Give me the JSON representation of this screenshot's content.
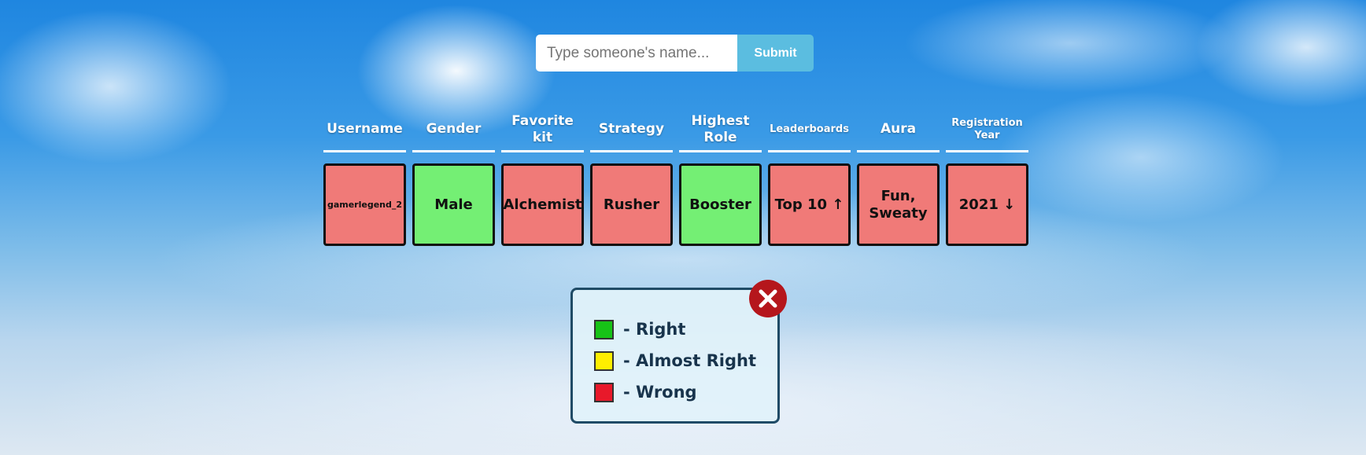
{
  "search": {
    "placeholder": "Type someone's name...",
    "submit_label": "Submit"
  },
  "columns": [
    {
      "label": "Username"
    },
    {
      "label": "Gender"
    },
    {
      "label": "Favorite kit"
    },
    {
      "label": "Strategy"
    },
    {
      "label": "Highest Role"
    },
    {
      "label": "Leaderboards"
    },
    {
      "label": "Aura"
    },
    {
      "label": "Registration Year"
    }
  ],
  "guess_row": [
    {
      "value": "gamerlegend_2",
      "status": "wrong"
    },
    {
      "value": "Male",
      "status": "right"
    },
    {
      "value": "Alchemist",
      "status": "wrong"
    },
    {
      "value": "Rusher",
      "status": "wrong"
    },
    {
      "value": "Booster",
      "status": "right"
    },
    {
      "value": "Top 10 ↑",
      "status": "wrong"
    },
    {
      "value": "Fun, Sweaty",
      "status": "wrong"
    },
    {
      "value": "2021 ↓",
      "status": "wrong"
    }
  ],
  "legend": {
    "items": [
      {
        "label": "- Right",
        "color": "#17c317"
      },
      {
        "label": "- Almost Right",
        "color": "#ffee00"
      },
      {
        "label": "- Wrong",
        "color": "#e8192a"
      }
    ],
    "close_icon": "close-icon"
  },
  "colors": {
    "right": "#74ef74",
    "wrong": "#f07a78",
    "submit": "#5bbde0",
    "close": "#b5161c"
  }
}
